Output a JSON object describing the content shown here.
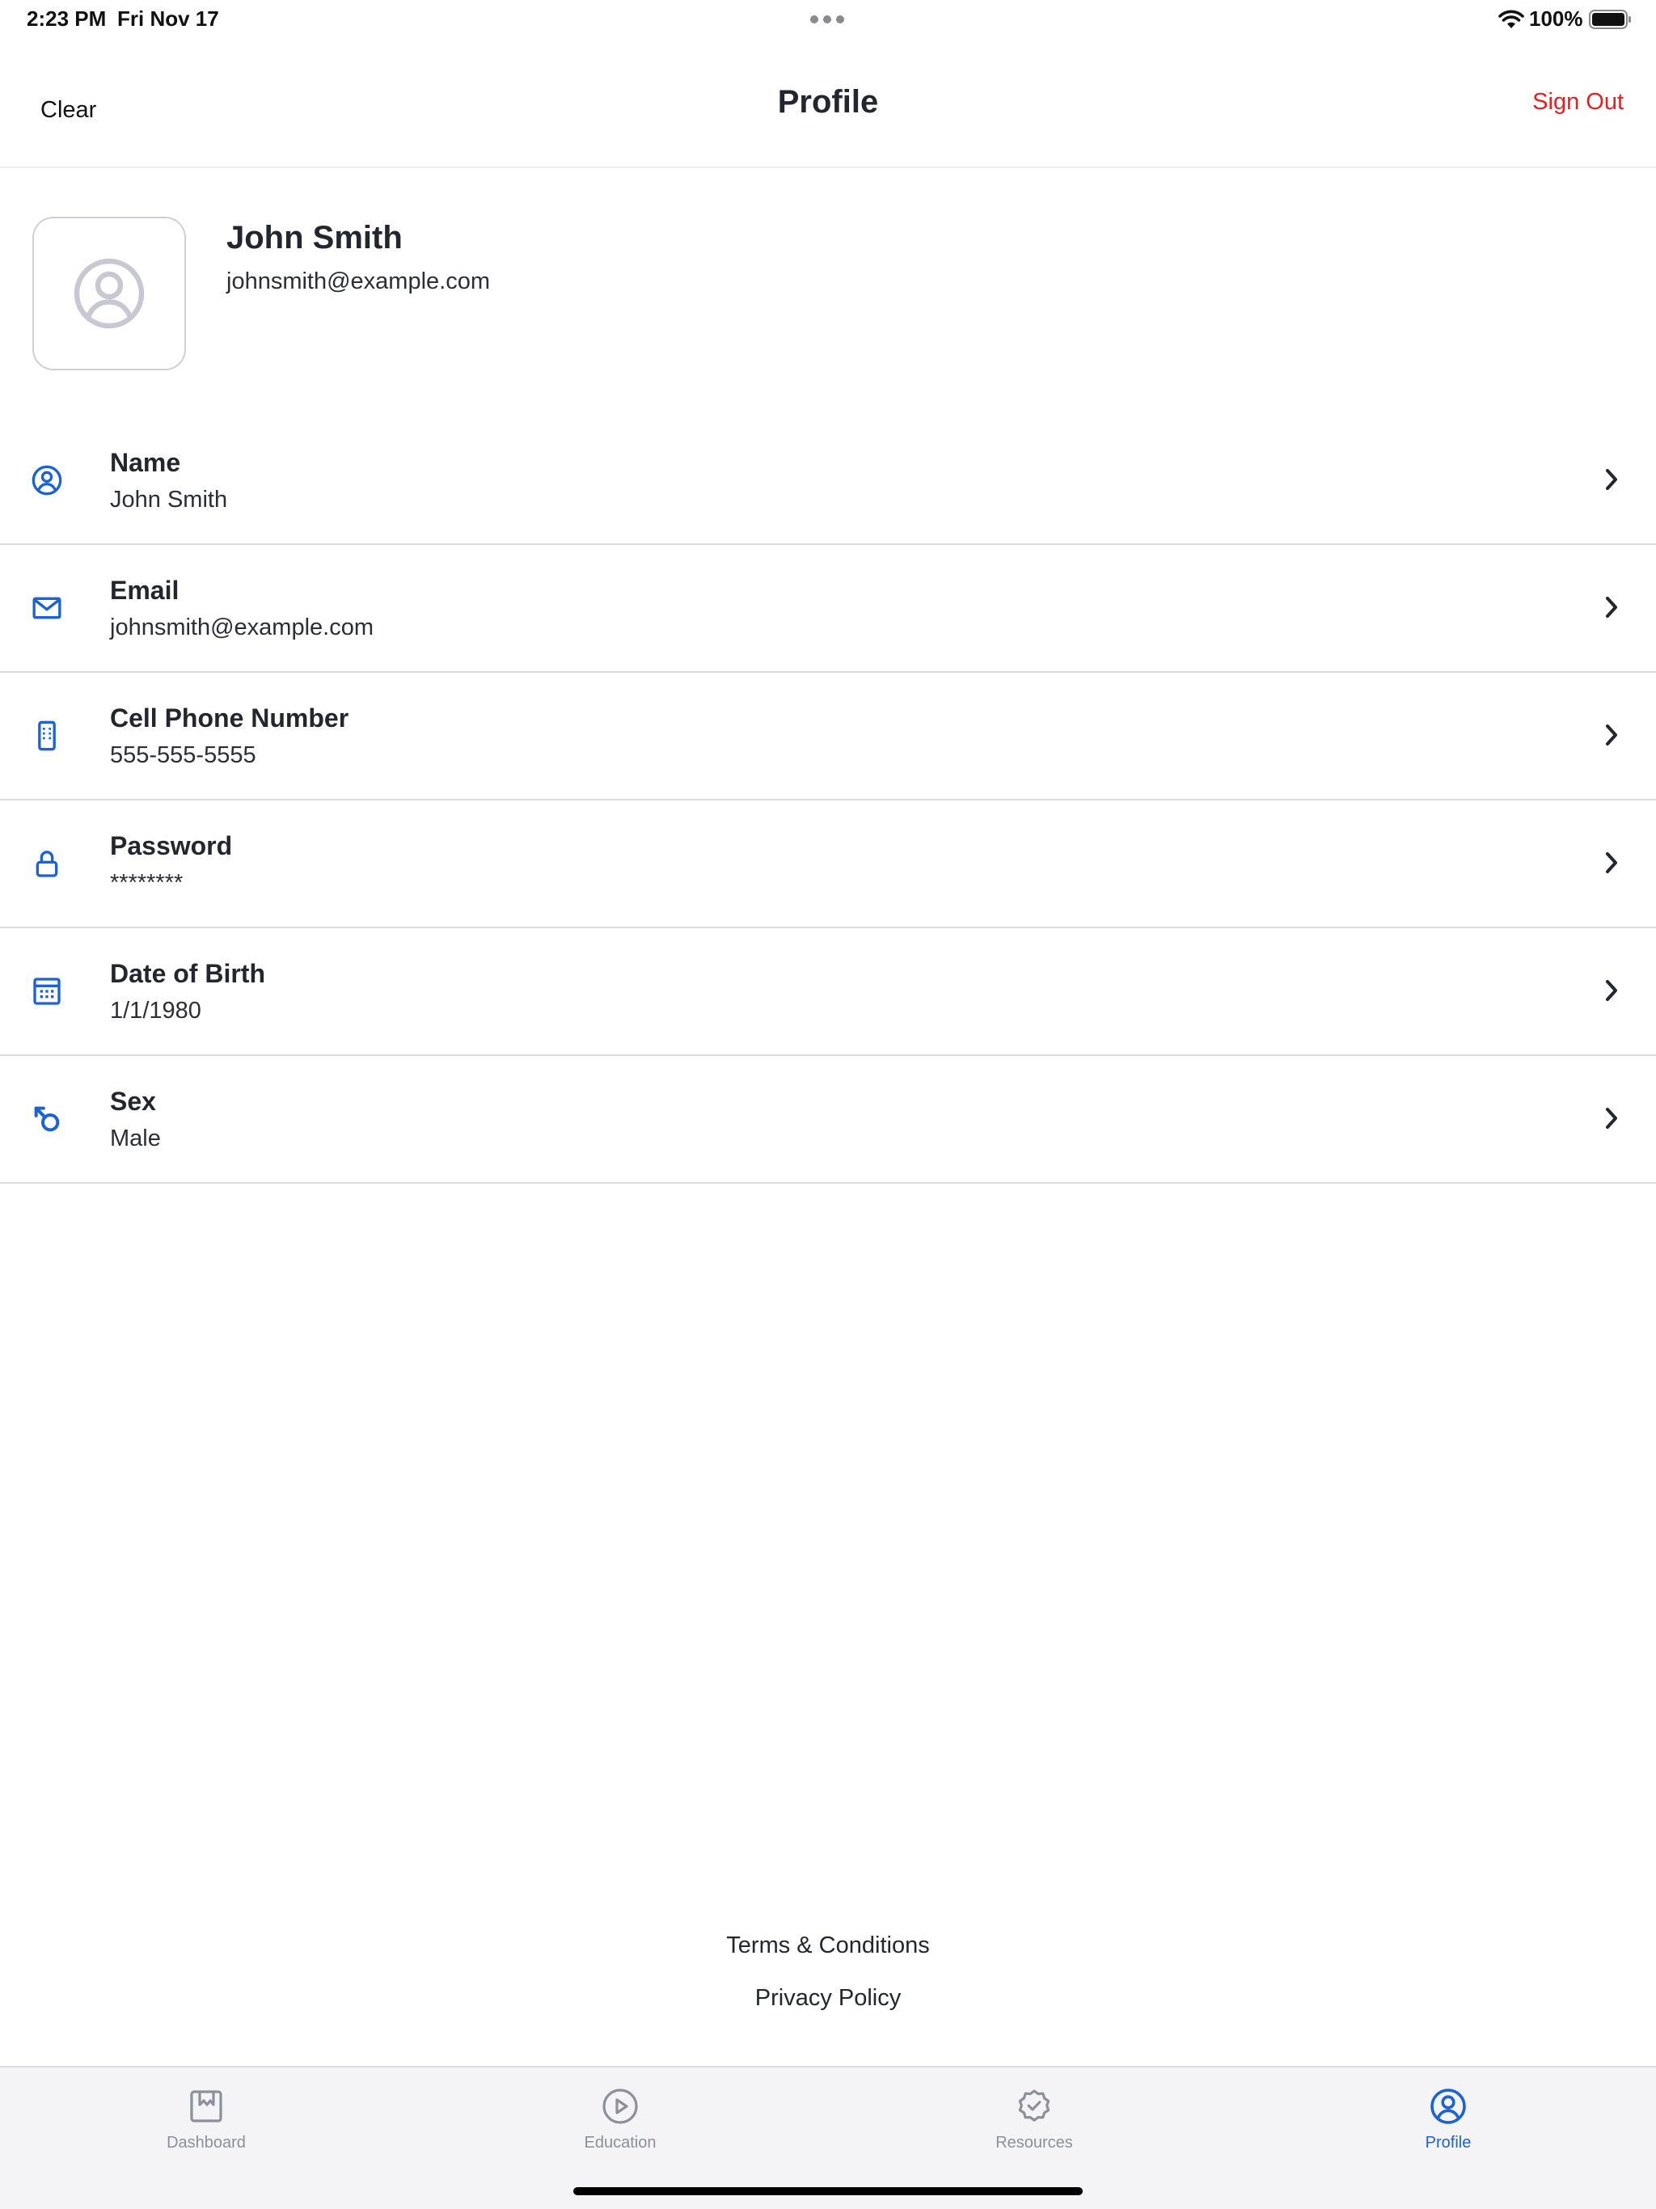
{
  "status_bar": {
    "time": "2:23 PM",
    "date": "Fri Nov 17",
    "battery": "100%"
  },
  "header": {
    "title": "Profile",
    "clear_label": "Clear",
    "sign_out_label": "Sign Out"
  },
  "profile": {
    "name": "John Smith",
    "email": "johnsmith@example.com",
    "avatar_icon": "user-circle-icon"
  },
  "fields": [
    {
      "label": "Name",
      "value": "John Smith",
      "icon": "user-circle-icon"
    },
    {
      "label": "Email",
      "value": "johnsmith@example.com",
      "icon": "mail-icon"
    },
    {
      "label": "Cell Phone Number",
      "value": "555-555-5555",
      "icon": "phone-icon"
    },
    {
      "label": "Password",
      "value": "********",
      "icon": "lock-icon"
    },
    {
      "label": "Date of Birth",
      "value": "1/1/1980",
      "icon": "calendar-icon"
    },
    {
      "label": "Sex",
      "value": "Male",
      "icon": "male-icon"
    }
  ],
  "footer": {
    "terms": "Terms & Conditions",
    "privacy": "Privacy Policy"
  },
  "tabs": [
    {
      "label": "Dashboard",
      "icon": "dashboard-icon",
      "active": false
    },
    {
      "label": "Education",
      "icon": "play-circle-icon",
      "active": false
    },
    {
      "label": "Resources",
      "icon": "badge-check-icon",
      "active": false
    },
    {
      "label": "Profile",
      "icon": "user-circle-icon",
      "active": true
    }
  ],
  "colors": {
    "accent": "#1a62d6",
    "destructive": "#ee1c1c",
    "text": "#23262f",
    "inactive_tab": "#8d8f99"
  }
}
